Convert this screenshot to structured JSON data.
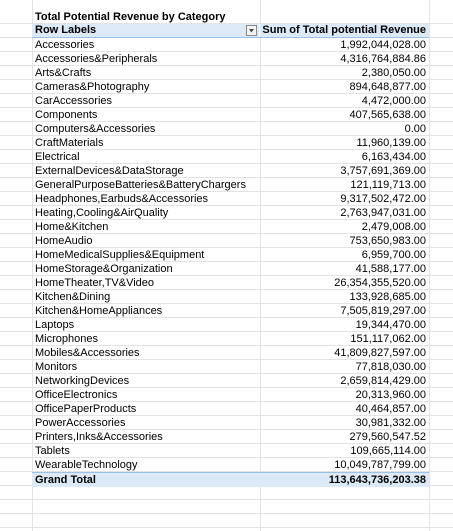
{
  "pivot": {
    "title": "Total Potential Revenue by Category",
    "header": {
      "row_labels": "Row Labels",
      "value_column": "Sum of Total potential Revenue"
    },
    "rows": [
      {
        "label": "Accessories",
        "value": "1,992,044,028.00"
      },
      {
        "label": "Accessories&Peripherals",
        "value": "4,316,764,884.86"
      },
      {
        "label": "Arts&Crafts",
        "value": "2,380,050.00"
      },
      {
        "label": "Cameras&Photography",
        "value": "894,648,877.00"
      },
      {
        "label": "CarAccessories",
        "value": "4,472,000.00"
      },
      {
        "label": "Components",
        "value": "407,565,638.00"
      },
      {
        "label": "Computers&Accessories",
        "value": "0.00"
      },
      {
        "label": "CraftMaterials",
        "value": "11,960,139.00"
      },
      {
        "label": "Electrical",
        "value": "6,163,434.00"
      },
      {
        "label": "ExternalDevices&DataStorage",
        "value": "3,757,691,369.00"
      },
      {
        "label": "GeneralPurposeBatteries&BatteryChargers",
        "value": "121,119,713.00"
      },
      {
        "label": "Headphones,Earbuds&Accessories",
        "value": "9,317,502,472.00"
      },
      {
        "label": "Heating,Cooling&AirQuality",
        "value": "2,763,947,031.00"
      },
      {
        "label": "Home&Kitchen",
        "value": "2,479,008.00"
      },
      {
        "label": "HomeAudio",
        "value": "753,650,983.00"
      },
      {
        "label": "HomeMedicalSupplies&Equipment",
        "value": "6,959,700.00"
      },
      {
        "label": "HomeStorage&Organization",
        "value": "41,588,177.00"
      },
      {
        "label": "HomeTheater,TV&Video",
        "value": "26,354,355,520.00"
      },
      {
        "label": "Kitchen&Dining",
        "value": "133,928,685.00"
      },
      {
        "label": "Kitchen&HomeAppliances",
        "value": "7,505,819,297.00"
      },
      {
        "label": "Laptops",
        "value": "19,344,470.00"
      },
      {
        "label": "Microphones",
        "value": "151,117,062.00"
      },
      {
        "label": "Mobiles&Accessories",
        "value": "41,809,827,597.00"
      },
      {
        "label": "Monitors",
        "value": "77,818,030.00"
      },
      {
        "label": "NetworkingDevices",
        "value": "2,659,814,429.00"
      },
      {
        "label": "OfficeElectronics",
        "value": "20,313,960.00"
      },
      {
        "label": "OfficePaperProducts",
        "value": "40,464,857.00"
      },
      {
        "label": "PowerAccessories",
        "value": "30,981,332.00"
      },
      {
        "label": "Printers,Inks&Accessories",
        "value": "279,560,547.52"
      },
      {
        "label": "Tablets",
        "value": "109,665,114.00"
      },
      {
        "label": "WearableTechnology",
        "value": "10,049,787,799.00"
      }
    ],
    "grand_total": {
      "label": "Grand Total",
      "value": "113,643,736,203.38"
    }
  },
  "icons": {
    "filter": "dropdown-filter-icon"
  },
  "colors": {
    "header_fill": "#dbeaf6",
    "header_border": "#9bc2e6",
    "grid": "#e3e3e3"
  }
}
